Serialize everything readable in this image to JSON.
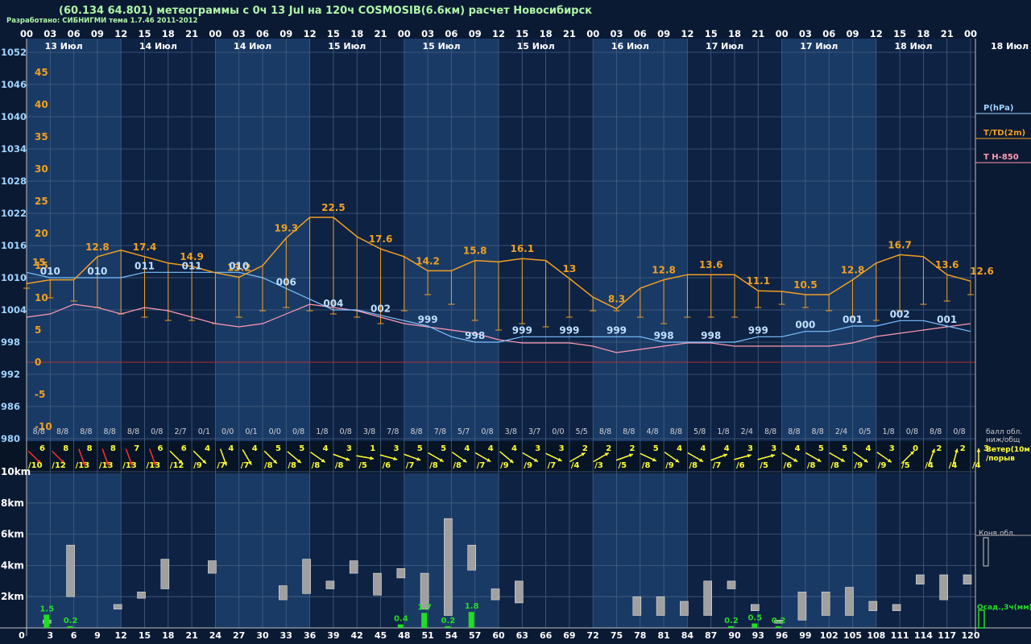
{
  "header": {
    "title": "(60.134 64.801) метеограммы с  0ч 13 Jul на 120ч COSMOSIB(6.6км) расчет Новосибирск",
    "subtitle": "Разработано: СИБНИГМИ тема 1.7.46 2011-2012"
  },
  "time_axis": {
    "hours": [
      "00",
      "03",
      "06",
      "09",
      "12",
      "15",
      "18",
      "21",
      "00",
      "03",
      "06",
      "09",
      "12",
      "15",
      "18",
      "21",
      "00",
      "03",
      "06",
      "09",
      "12",
      "15",
      "18",
      "21",
      "00",
      "03",
      "06",
      "09",
      "12",
      "15",
      "18",
      "21",
      "00",
      "03",
      "06",
      "09",
      "12",
      "15",
      "18",
      "21",
      "00"
    ],
    "date_labels": [
      {
        "label": "13 Июл",
        "col": 0.5
      },
      {
        "label": "14 Июл",
        "col": 4.5
      },
      {
        "label": "14 Июл",
        "col": 8.5
      },
      {
        "label": "15 Июл",
        "col": 12.5
      },
      {
        "label": "15 Июл",
        "col": 16.5
      },
      {
        "label": "15 Июл",
        "col": 20.5
      },
      {
        "label": "16 Июл",
        "col": 24.5
      },
      {
        "label": "17 Июл",
        "col": 28.5
      },
      {
        "label": "17 Июл",
        "col": 32.5
      },
      {
        "label": "18 Июл",
        "col": 36.5
      }
    ],
    "right_date": "18 Июл",
    "forecast_hours": [
      "0",
      "3",
      "6",
      "9",
      "12",
      "15",
      "18",
      "21",
      "24",
      "27",
      "30",
      "33",
      "36",
      "39",
      "42",
      "45",
      "48",
      "51",
      "54",
      "57",
      "60",
      "63",
      "66",
      "69",
      "72",
      "75",
      "78",
      "81",
      "84",
      "87",
      "90",
      "93",
      "96",
      "99",
      "102",
      "105",
      "108",
      "111",
      "114",
      "117",
      "120"
    ]
  },
  "pressure_axis": {
    "ticks": [
      "1052",
      "1046",
      "1040",
      "1034",
      "1028",
      "1022",
      "1016",
      "1010",
      "1004",
      "998",
      "992",
      "986",
      "980"
    ]
  },
  "temp_axis": {
    "ticks": [
      "45",
      "40",
      "35",
      "30",
      "25",
      "20",
      "15",
      "10",
      "5",
      "0",
      "-5",
      "-10"
    ]
  },
  "legend": {
    "pressure": "P(hPa)",
    "temperature": "T/TD(2m)",
    "t850": "T H-850",
    "clouds": "балл обл.",
    "clouds2": "ниж/общ",
    "wind": "Ветер(10м)",
    "gust": "/порыв",
    "conv": "Конв.обл.",
    "precip": "Осад.,3ч(мм)"
  },
  "height_axis": {
    "ticks": [
      "10km",
      "8km",
      "6km",
      "4km",
      "2km"
    ]
  },
  "colors": {
    "background": "#0b1a33",
    "panel_light": "#1a3a66",
    "panel_dark": "#0e2244",
    "pressure": "#7cc4ff",
    "temperature": "#f0a020",
    "t850": "#ff9ab0",
    "zero_line": "#b03030",
    "wind_yellow": "#ffff33",
    "wind_red": "#ff3030",
    "precip": "#22dd22",
    "cloud_bar": "#a0a0a0",
    "grid": "#44607f"
  },
  "chart_data": {
    "type": "line",
    "title": "",
    "x_hours": [
      0,
      3,
      6,
      9,
      12,
      15,
      18,
      21,
      24,
      27,
      30,
      33,
      36,
      39,
      42,
      45,
      48,
      51,
      54,
      57,
      60,
      63,
      66,
      69,
      72,
      75,
      78,
      81,
      84,
      87,
      90,
      93,
      96,
      99,
      102,
      105,
      108,
      111,
      114,
      117,
      120
    ],
    "pressure_hpa": [
      1011,
      1010,
      1010,
      1010,
      1010,
      1011,
      1011,
      1011,
      1011,
      1011,
      1010,
      1008,
      1006,
      1004,
      1004,
      1003,
      1002,
      1001,
      999,
      998,
      998,
      999,
      999,
      999,
      999,
      999,
      999,
      998,
      998,
      998,
      998,
      999,
      999,
      1000,
      1000,
      1001,
      1001,
      1002,
      1002,
      1001,
      1000
    ],
    "pressure_labels": [
      {
        "h": 3,
        "v": "010"
      },
      {
        "h": 9,
        "v": "010"
      },
      {
        "h": 15,
        "v": "011"
      },
      {
        "h": 21,
        "v": "011"
      },
      {
        "h": 27,
        "v": "010"
      },
      {
        "h": 33,
        "v": "006"
      },
      {
        "h": 39,
        "v": "004"
      },
      {
        "h": 45,
        "v": "002"
      },
      {
        "h": 51,
        "v": "999"
      },
      {
        "h": 57,
        "v": "998"
      },
      {
        "h": 63,
        "v": "999"
      },
      {
        "h": 69,
        "v": "999"
      },
      {
        "h": 75,
        "v": "999"
      },
      {
        "h": 81,
        "v": "998"
      },
      {
        "h": 87,
        "v": "998"
      },
      {
        "h": 93,
        "v": "999"
      },
      {
        "h": 99,
        "v": "000"
      },
      {
        "h": 105,
        "v": "001"
      },
      {
        "h": 111,
        "v": "002"
      },
      {
        "h": 117,
        "v": "001"
      }
    ],
    "temperature_c": [
      12.2,
      12.8,
      12.8,
      16.4,
      17.4,
      16.4,
      15.4,
      14.9,
      13.9,
      13.2,
      15.0,
      19.3,
      22.5,
      22.5,
      19.5,
      17.6,
      16.4,
      14.2,
      14.2,
      15.8,
      15.6,
      16.1,
      15.8,
      13.0,
      10.1,
      8.3,
      11.5,
      12.8,
      13.6,
      13.6,
      13.6,
      11.1,
      11.0,
      10.5,
      10.5,
      12.8,
      15.4,
      16.7,
      16.4,
      13.6,
      12.6
    ],
    "dewpoint_c": [
      11.5,
      10.0,
      9.5,
      8.5,
      7.5,
      7.0,
      6.5,
      6.5,
      6.0,
      7.0,
      8.0,
      8.5,
      8.0,
      7.5,
      7.0,
      6.0,
      8.0,
      10.5,
      9.0,
      6.5,
      5.0,
      6.0,
      5.5,
      7.0,
      8.0,
      8.0,
      7.0,
      6.0,
      7.0,
      7.0,
      7.0,
      8.5,
      9.0,
      8.5,
      8.0,
      7.0,
      6.5,
      8.0,
      9.0,
      9.5,
      10.5
    ],
    "temperature_labels": [
      {
        "h": 0,
        "v": ""
      },
      {
        "h": 9,
        "v": "12.8"
      },
      {
        "h": 15,
        "v": "17.4"
      },
      {
        "h": 21,
        "v": "14.9"
      },
      {
        "h": 27,
        "v": "13.2"
      },
      {
        "h": 33,
        "v": "19.3"
      },
      {
        "h": 39,
        "v": "22.5"
      },
      {
        "h": 45,
        "v": "17.6"
      },
      {
        "h": 51,
        "v": "14.2"
      },
      {
        "h": 57,
        "v": "15.8"
      },
      {
        "h": 63,
        "v": "16.1"
      },
      {
        "h": 69,
        "v": "13"
      },
      {
        "h": 75,
        "v": "8.3"
      },
      {
        "h": 81,
        "v": "12.8"
      },
      {
        "h": 87,
        "v": "13.6"
      },
      {
        "h": 93,
        "v": "11.1"
      },
      {
        "h": 99,
        "v": "10.5"
      },
      {
        "h": 105,
        "v": "12.8"
      },
      {
        "h": 111,
        "v": "16.7"
      },
      {
        "h": 117,
        "v": "13.6"
      },
      {
        "h": 123,
        "v": "12.6"
      }
    ],
    "t850_c": [
      7.0,
      7.5,
      9.0,
      8.5,
      7.5,
      8.5,
      8.0,
      7.0,
      6.0,
      5.5,
      6.0,
      7.5,
      9.0,
      8.5,
      8.0,
      7.0,
      6.0,
      5.5,
      5.0,
      4.5,
      3.5,
      3.0,
      3.0,
      3.0,
      2.5,
      1.5,
      2.0,
      2.5,
      3.0,
      3.0,
      2.5,
      2.5,
      2.5,
      2.5,
      2.5,
      3.0,
      4.0,
      4.5,
      5.0,
      5.5,
      6.0
    ],
    "clouds": [
      "8/8",
      "8/8",
      "8/8",
      "8/8",
      "8/8",
      "0/8",
      "2/7",
      "0/1",
      "0/0",
      "0/1",
      "0/0",
      "0/8",
      "1/8",
      "0/8",
      "3/8",
      "7/8",
      "8/8",
      "7/8",
      "5/7",
      "0/8",
      "3/8",
      "3/7",
      "0/0",
      "5/5",
      "8/8",
      "8/8",
      "4/8",
      "8/8",
      "5/8",
      "1/8",
      "2/4",
      "8/8",
      "8/8",
      "8/8",
      "2/4",
      "0/5",
      "1/8",
      "0/8",
      "8/8",
      "0/8"
    ],
    "wind": [
      {
        "s": "6",
        "g": "/10",
        "c": "red",
        "d": 135
      },
      {
        "s": "8",
        "g": "/12",
        "c": "red",
        "d": 135
      },
      {
        "s": "8",
        "g": "/13",
        "c": "red",
        "d": 160
      },
      {
        "s": "8",
        "g": "/13",
        "c": "red",
        "d": 160
      },
      {
        "s": "7",
        "g": "/13",
        "c": "red",
        "d": 160
      },
      {
        "s": "6",
        "g": "/13",
        "c": "red",
        "d": 160
      },
      {
        "s": "6",
        "g": "/12",
        "c": "yellow",
        "d": 135
      },
      {
        "s": "4",
        "g": "/9",
        "c": "yellow",
        "d": 135
      },
      {
        "s": "4",
        "g": "/7",
        "c": "yellow",
        "d": 160
      },
      {
        "s": "4",
        "g": "/7",
        "c": "yellow",
        "d": 150
      },
      {
        "s": "5",
        "g": "/8",
        "c": "yellow",
        "d": 135
      },
      {
        "s": "5",
        "g": "/8",
        "c": "yellow",
        "d": 130
      },
      {
        "s": "4",
        "g": "/8",
        "c": "yellow",
        "d": 125
      },
      {
        "s": "3",
        "g": "/8",
        "c": "yellow",
        "d": 110
      },
      {
        "s": "1",
        "g": "/5",
        "c": "yellow",
        "d": 100
      },
      {
        "s": "3",
        "g": "/6",
        "c": "yellow",
        "d": 105
      },
      {
        "s": "5",
        "g": "/7",
        "c": "yellow",
        "d": 110
      },
      {
        "s": "5",
        "g": "/8",
        "c": "yellow",
        "d": 120
      },
      {
        "s": "4",
        "g": "/8",
        "c": "yellow",
        "d": 125
      },
      {
        "s": "4",
        "g": "/7",
        "c": "yellow",
        "d": 120
      },
      {
        "s": "4",
        "g": "/9",
        "c": "yellow",
        "d": 130
      },
      {
        "s": "3",
        "g": "/9",
        "c": "yellow",
        "d": 120
      },
      {
        "s": "3",
        "g": "/7",
        "c": "yellow",
        "d": 115
      },
      {
        "s": "2",
        "g": "/4",
        "c": "yellow",
        "d": 60
      },
      {
        "s": "2",
        "g": "/3",
        "c": "yellow",
        "d": 60
      },
      {
        "s": "2",
        "g": "/5",
        "c": "yellow",
        "d": 70
      },
      {
        "s": "5",
        "g": "/8",
        "c": "yellow",
        "d": 115
      },
      {
        "s": "4",
        "g": "/9",
        "c": "yellow",
        "d": 125
      },
      {
        "s": "4",
        "g": "/8",
        "c": "yellow",
        "d": 120
      },
      {
        "s": "4",
        "g": "/7",
        "c": "yellow",
        "d": 70
      },
      {
        "s": "3",
        "g": "/6",
        "c": "yellow",
        "d": 75
      },
      {
        "s": "3",
        "g": "/5",
        "c": "yellow",
        "d": 75
      },
      {
        "s": "4",
        "g": "/6",
        "c": "yellow",
        "d": 120
      },
      {
        "s": "5",
        "g": "/8",
        "c": "yellow",
        "d": 120
      },
      {
        "s": "5",
        "g": "/8",
        "c": "yellow",
        "d": 120
      },
      {
        "s": "4",
        "g": "/9",
        "c": "yellow",
        "d": 125
      },
      {
        "s": "3",
        "g": "/9",
        "c": "yellow",
        "d": 125
      },
      {
        "s": "0",
        "g": "/5",
        "c": "yellow",
        "d": 45
      },
      {
        "s": "2",
        "g": "/4",
        "c": "yellow",
        "d": 20
      },
      {
        "s": "2",
        "g": "/4",
        "c": "yellow",
        "d": 15
      },
      {
        "s": "3",
        "g": "/4",
        "c": "yellow",
        "d": 0
      }
    ],
    "conv_clouds_km": [
      {
        "h": 3,
        "b": 0.3,
        "t": 0.5
      },
      {
        "h": 6,
        "b": 2.0,
        "t": 5.3
      },
      {
        "h": 12,
        "b": 1.2,
        "t": 1.5
      },
      {
        "h": 15,
        "b": 1.9,
        "t": 2.3
      },
      {
        "h": 18,
        "b": 2.5,
        "t": 4.4
      },
      {
        "h": 24,
        "b": 3.5,
        "t": 4.3
      },
      {
        "h": 33,
        "b": 1.8,
        "t": 2.7
      },
      {
        "h": 36,
        "b": 2.2,
        "t": 4.4
      },
      {
        "h": 39,
        "b": 2.5,
        "t": 3.0
      },
      {
        "h": 42,
        "b": 3.5,
        "t": 4.3
      },
      {
        "h": 45,
        "b": 2.1,
        "t": 3.5
      },
      {
        "h": 48,
        "b": 3.2,
        "t": 3.8
      },
      {
        "h": 51,
        "b": 1.2,
        "t": 3.5
      },
      {
        "h": 54,
        "b": 0.8,
        "t": 7.0
      },
      {
        "h": 57,
        "b": 3.7,
        "t": 5.3
      },
      {
        "h": 60,
        "b": 1.8,
        "t": 2.5
      },
      {
        "h": 63,
        "b": 1.6,
        "t": 3.0
      },
      {
        "h": 78,
        "b": 0.8,
        "t": 2.0
      },
      {
        "h": 81,
        "b": 0.8,
        "t": 2.0
      },
      {
        "h": 84,
        "b": 0.8,
        "t": 1.7
      },
      {
        "h": 87,
        "b": 0.8,
        "t": 3.0
      },
      {
        "h": 90,
        "b": 2.5,
        "t": 3.0
      },
      {
        "h": 93,
        "b": 1.1,
        "t": 1.5
      },
      {
        "h": 96,
        "b": 0.3,
        "t": 0.5
      },
      {
        "h": 99,
        "b": 0.5,
        "t": 2.3
      },
      {
        "h": 102,
        "b": 0.8,
        "t": 2.3
      },
      {
        "h": 105,
        "b": 0.8,
        "t": 2.6
      },
      {
        "h": 108,
        "b": 1.1,
        "t": 1.7
      },
      {
        "h": 111,
        "b": 1.1,
        "t": 1.5
      },
      {
        "h": 114,
        "b": 2.8,
        "t": 3.4
      },
      {
        "h": 117,
        "b": 1.8,
        "t": 3.4
      },
      {
        "h": 120,
        "b": 2.8,
        "t": 3.4
      }
    ],
    "precip_mm": [
      {
        "h": 3,
        "v": 1.5
      },
      {
        "h": 6,
        "v": 0.2
      },
      {
        "h": 48,
        "v": 0.4
      },
      {
        "h": 51,
        "v": 1.7
      },
      {
        "h": 54,
        "v": 0.2
      },
      {
        "h": 57,
        "v": 1.8
      },
      {
        "h": 90,
        "v": 0.2
      },
      {
        "h": 93,
        "v": 0.5
      },
      {
        "h": 96,
        "v": 0.2
      }
    ]
  }
}
